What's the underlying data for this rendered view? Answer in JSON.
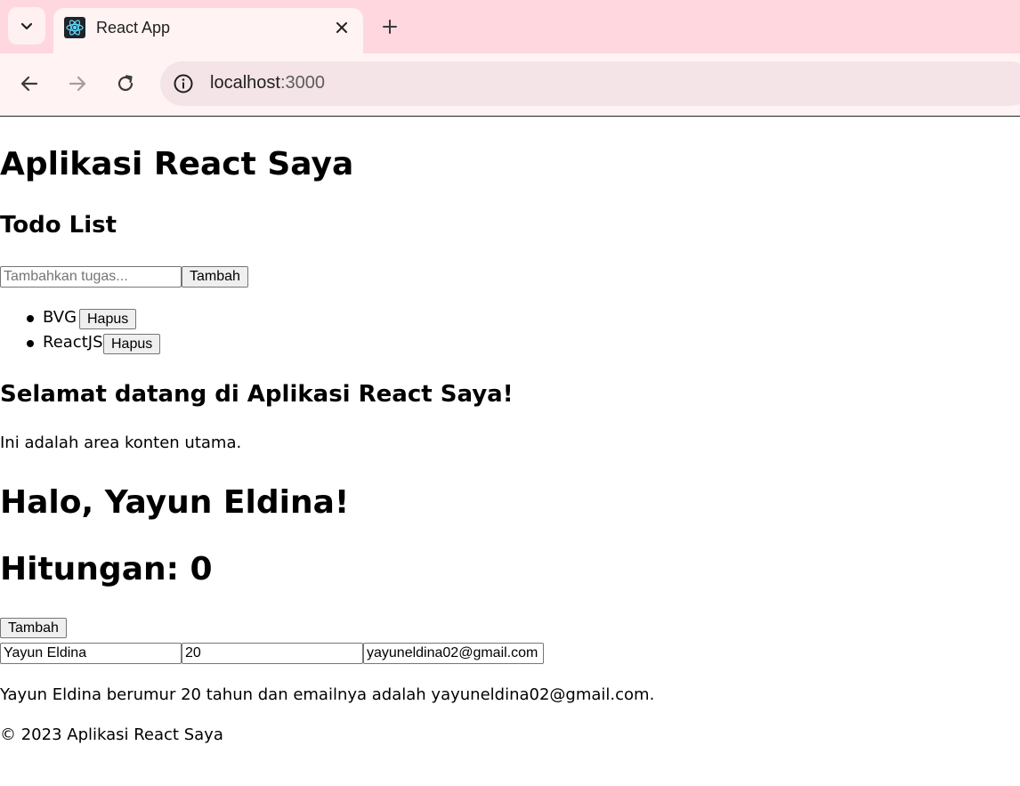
{
  "browser": {
    "tab_title": "React App",
    "url_host": "localhost",
    "url_port": ":3000"
  },
  "page": {
    "app_title": "Aplikasi React Saya",
    "todo": {
      "heading": "Todo List",
      "input_placeholder": "Tambahkan tugas...",
      "input_value": "",
      "add_label": "Tambah",
      "items": [
        {
          "text": "BVG",
          "delete_label": "Hapus"
        },
        {
          "text": "ReactJS",
          "delete_label": "Hapus"
        }
      ]
    },
    "main": {
      "welcome_heading": "Selamat datang di Aplikasi React Saya!",
      "welcome_text": "Ini adalah area konten utama."
    },
    "greeting": "Halo, Yayun Eldina!",
    "counter": {
      "label": "Hitungan: 0",
      "button_label": "Tambah"
    },
    "profile": {
      "name_value": "Yayun Eldina",
      "age_value": "20",
      "email_value": "yayuneldina02@gmail.com",
      "summary": "Yayun Eldina berumur 20 tahun dan emailnya adalah yayuneldina02@gmail.com."
    },
    "footer": "© 2023 Aplikasi React Saya"
  }
}
